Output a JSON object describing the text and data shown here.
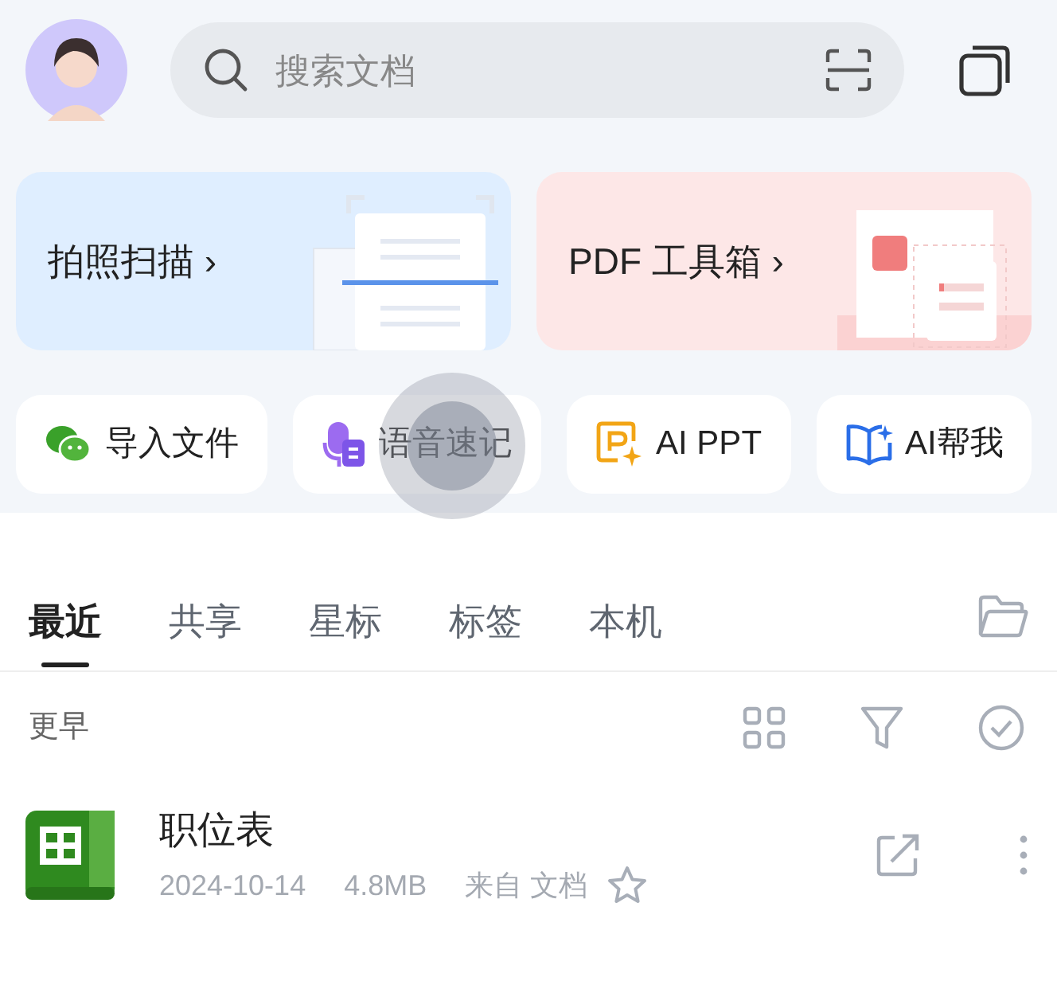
{
  "search": {
    "placeholder": "搜索文档"
  },
  "feature_cards": [
    {
      "kind": "scan",
      "label": "拍照扫描 ›"
    },
    {
      "kind": "pdf",
      "label": "PDF 工具箱 ›"
    }
  ],
  "quick_actions": [
    {
      "kind": "chat",
      "label": "导入文件"
    },
    {
      "kind": "voice",
      "label": "语音速记"
    },
    {
      "kind": "ppt",
      "label": "AI PPT"
    },
    {
      "kind": "book",
      "label": "AI帮我"
    }
  ],
  "touch_indicator": true,
  "tabs": [
    {
      "label": "最近",
      "selected": true
    },
    {
      "label": "共享",
      "selected": false
    },
    {
      "label": "星标",
      "selected": false
    },
    {
      "label": "标签",
      "selected": false
    },
    {
      "label": "本机",
      "selected": false
    }
  ],
  "section_label": "更早",
  "files": [
    {
      "kind": "sheet",
      "name": "职位表",
      "date": "2024-10-14",
      "size": "4.8MB",
      "source": "来自 文档",
      "starred": false
    }
  ]
}
